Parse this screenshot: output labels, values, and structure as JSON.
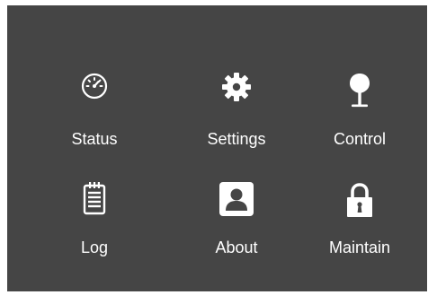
{
  "menu": {
    "items": [
      {
        "id": "status",
        "label": "Status",
        "icon": "speedometer-icon"
      },
      {
        "id": "settings",
        "label": "Settings",
        "icon": "gear-icon"
      },
      {
        "id": "control",
        "label": "Control",
        "icon": "joystick-icon"
      },
      {
        "id": "log",
        "label": "Log",
        "icon": "notepad-icon"
      },
      {
        "id": "about",
        "label": "About",
        "icon": "user-icon"
      },
      {
        "id": "maintain",
        "label": "Maintain",
        "icon": "lock-icon"
      }
    ]
  },
  "colors": {
    "panel_background": "#454545",
    "page_background": "#ffffff",
    "foreground": "#ffffff"
  }
}
